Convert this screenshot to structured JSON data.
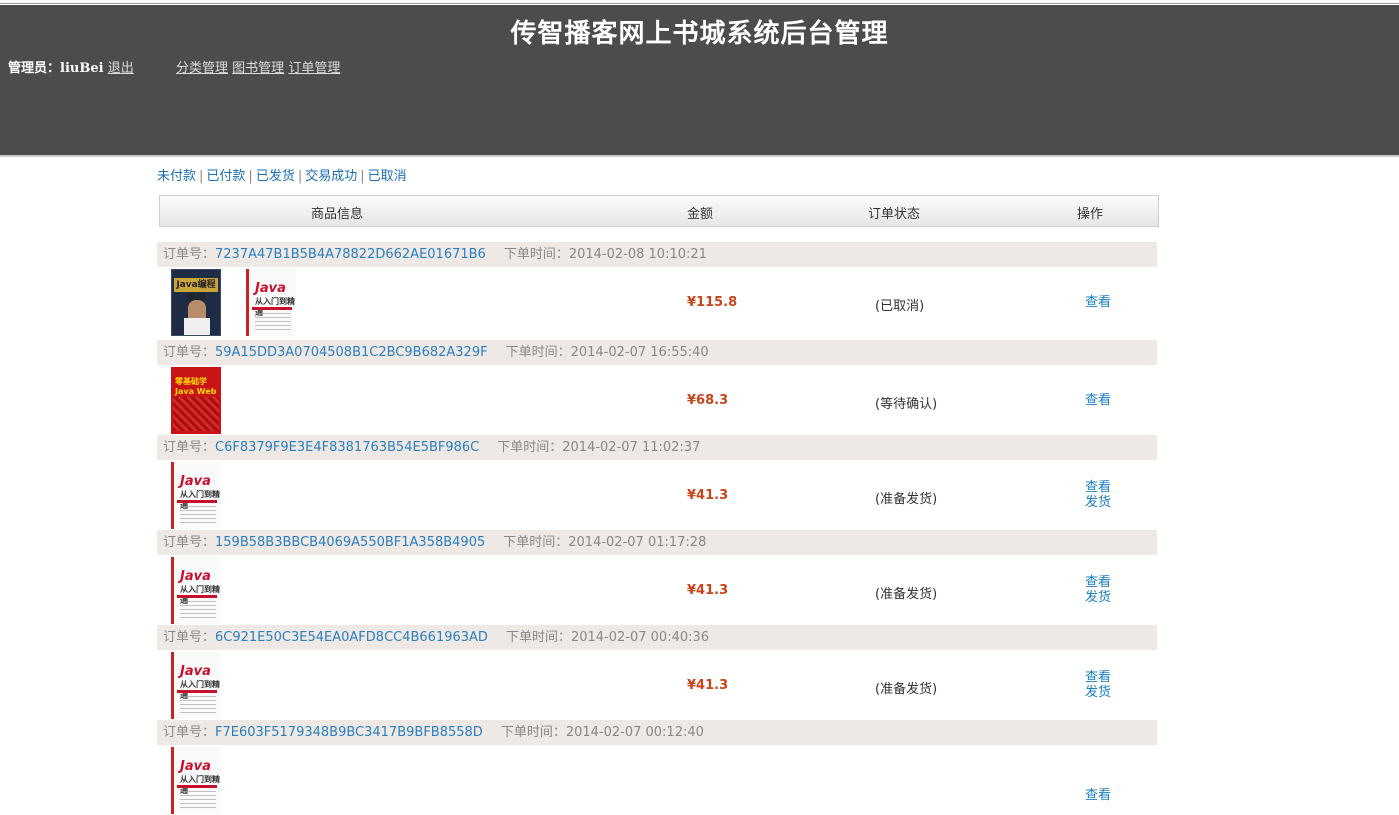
{
  "header": {
    "title": "传智播客网上书城系统后台管理",
    "admin_label": "管理员：",
    "admin_name": "liuBei",
    "logout": "退出",
    "nav": [
      "分类管理",
      "图书管理",
      "订单管理"
    ]
  },
  "filters": [
    "未付款",
    "已付款",
    "已发货",
    "交易成功",
    "已取消"
  ],
  "table_head": {
    "product": "商品信息",
    "amount": "金额",
    "status": "订单状态",
    "action": "操作"
  },
  "order_labels": {
    "id_label": "订单号：",
    "time_label": "下单时间："
  },
  "orders": [
    {
      "id": "7237A47B1B5B4A78822D662AE01671B6",
      "time": "2014-02-08 10:10:21",
      "amount": "¥115.8",
      "status": "(已取消)",
      "actions": [
        "查看"
      ],
      "books": [
        {
          "cover": "dark",
          "title": "Java编程思想"
        },
        {
          "cover": "white",
          "title": "Java",
          "subtitle": "从入门到精通"
        }
      ]
    },
    {
      "id": "59A15DD3A0704508B1C2BC9B682A329F",
      "time": "2014-02-07 16:55:40",
      "amount": "¥68.3",
      "status": "(等待确认)",
      "actions": [
        "查看"
      ],
      "books": [
        {
          "cover": "red",
          "title": "零基础学Java Web"
        }
      ]
    },
    {
      "id": "C6F8379F9E3E4F8381763B54E5BF986C",
      "time": "2014-02-07 11:02:37",
      "amount": "¥41.3",
      "status": "(准备发货)",
      "actions": [
        "查看",
        "发货"
      ],
      "books": [
        {
          "cover": "white",
          "title": "Java",
          "subtitle": "从入门到精通"
        }
      ]
    },
    {
      "id": "159B58B3BBCB4069A550BF1A358B4905",
      "time": "2014-02-07 01:17:28",
      "amount": "¥41.3",
      "status": "(准备发货)",
      "actions": [
        "查看",
        "发货"
      ],
      "books": [
        {
          "cover": "white",
          "title": "Java",
          "subtitle": "从入门到精通"
        }
      ]
    },
    {
      "id": "6C921E50C3E54EA0AFD8CC4B661963AD",
      "time": "2014-02-07 00:40:36",
      "amount": "¥41.3",
      "status": "(准备发货)",
      "actions": [
        "查看",
        "发货"
      ],
      "books": [
        {
          "cover": "white",
          "title": "Java",
          "subtitle": "从入门到精通"
        }
      ]
    },
    {
      "id": "F7E603F5179348B9BC3417B9BFB8558D",
      "time": "2014-02-07 00:12:40",
      "amount": "",
      "status": "",
      "actions": [
        "查看"
      ],
      "books": [
        {
          "cover": "white",
          "title": "Java",
          "subtitle": "从入门到精通"
        }
      ]
    }
  ]
}
